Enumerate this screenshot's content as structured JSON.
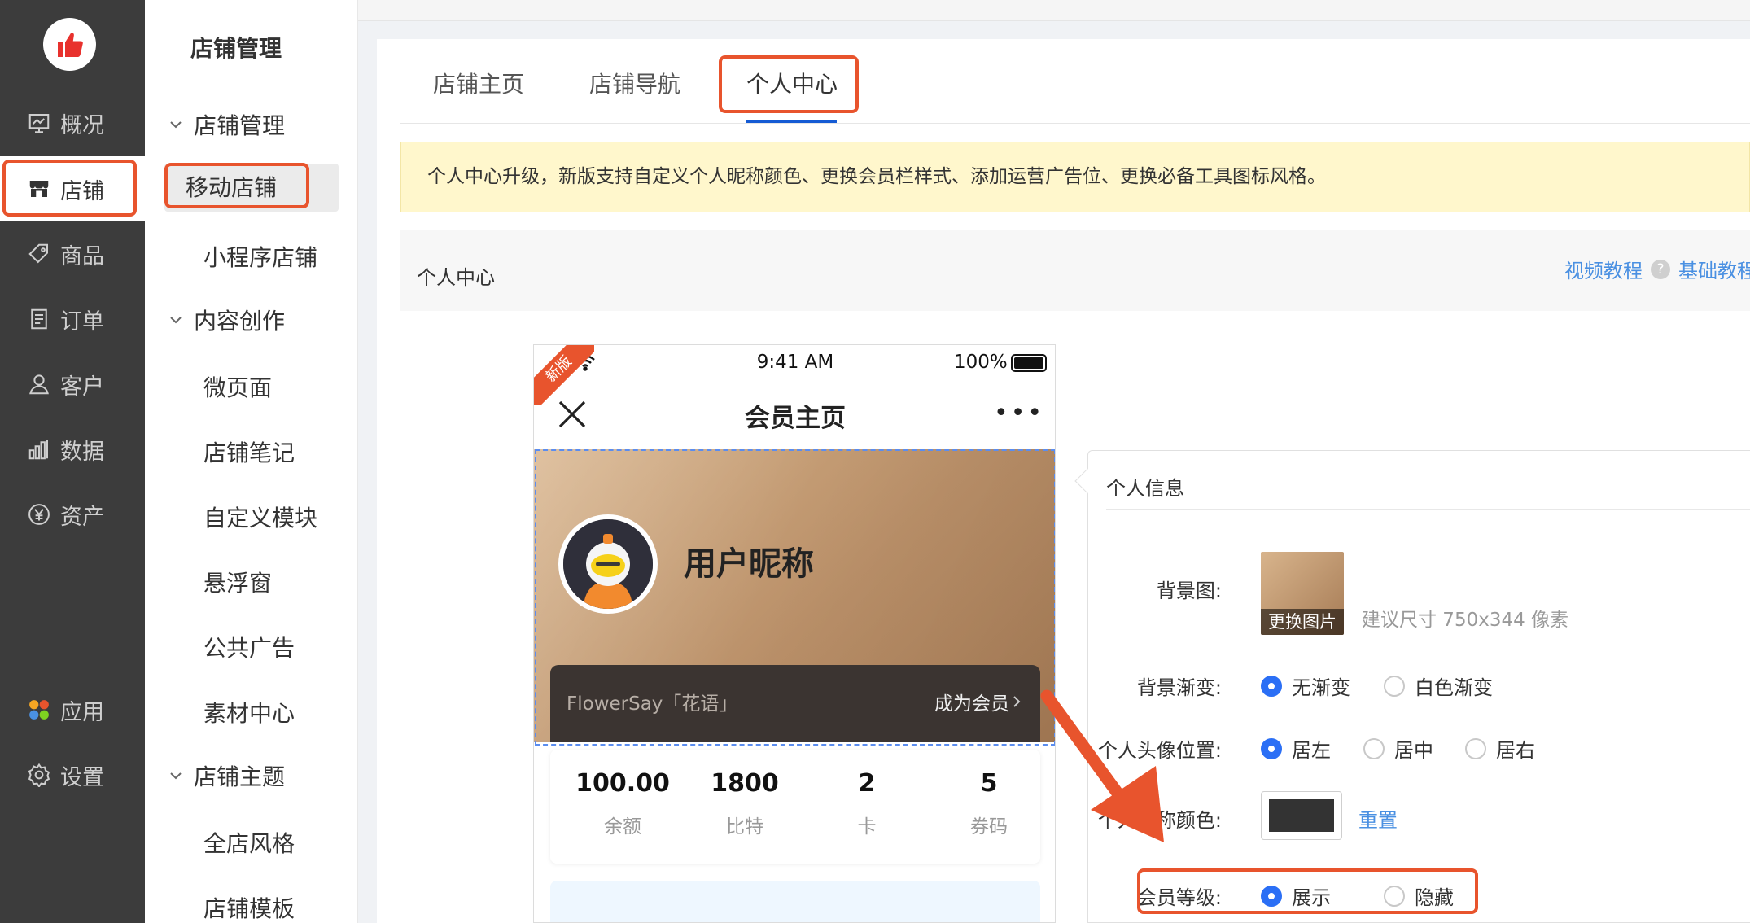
{
  "sidebar": {
    "items": [
      {
        "label": "概况",
        "icon": "overview-icon"
      },
      {
        "label": "店铺",
        "icon": "store-icon"
      },
      {
        "label": "商品",
        "icon": "tag-icon"
      },
      {
        "label": "订单",
        "icon": "order-icon"
      },
      {
        "label": "客户",
        "icon": "user-icon"
      },
      {
        "label": "数据",
        "icon": "chart-icon"
      },
      {
        "label": "资产",
        "icon": "yuan-icon"
      },
      {
        "label": "应用",
        "icon": "apps-icon"
      },
      {
        "label": "设置",
        "icon": "gear-icon"
      }
    ]
  },
  "subnav": {
    "heading": "店铺管理",
    "groups": [
      {
        "label": "店铺管理",
        "items": [
          "移动店铺",
          "小程序店铺"
        ]
      },
      {
        "label": "内容创作",
        "items": [
          "微页面",
          "店铺笔记",
          "自定义模块",
          "悬浮窗",
          "公共广告",
          "素材中心"
        ]
      },
      {
        "label": "店铺主题",
        "items": [
          "全店风格",
          "店铺模板"
        ]
      }
    ]
  },
  "tabs": [
    "店铺主页",
    "店铺导航",
    "个人中心"
  ],
  "notice": "个人中心升级，新版支持自定义个人昵称颜色、更换会员栏样式、添加运营广告位、更换必备工具图标风格。",
  "section": {
    "title": "个人中心",
    "video_tutorial": "视频教程",
    "help_mark": "?",
    "basic_tutorial": "基础教程"
  },
  "phone": {
    "ribbon": "新版",
    "time": "9:41 AM",
    "battery": "100%",
    "title": "会员主页",
    "more": "•••",
    "nickname": "用户昵称",
    "member_brand": "FlowerSay「花语」",
    "member_join": "成为会员",
    "stats": [
      {
        "value": "100.00",
        "label": "余额"
      },
      {
        "value": "1800",
        "label": "比特"
      },
      {
        "value": "2",
        "label": "卡"
      },
      {
        "value": "5",
        "label": "券码"
      }
    ]
  },
  "panel": {
    "title": "个人信息",
    "bg_label": "背景图:",
    "change_image": "更换图片",
    "size_hint": "建议尺寸 750x344 像素",
    "gradient_label": "背景渐变:",
    "gradient_options": [
      "无渐变",
      "白色渐变"
    ],
    "avatar_pos_label": "个人头像位置:",
    "avatar_pos_options": [
      "居左",
      "居中",
      "居右"
    ],
    "nick_color_label": "个人昵称颜色:",
    "reset": "重置",
    "level_label": "会员等级:",
    "level_options": [
      "展示",
      "隐藏"
    ]
  },
  "colors": {
    "accent": "#e8542d",
    "link": "#4a90e2",
    "radio_on": "#2b6ff5",
    "nick_color": "#333333"
  }
}
